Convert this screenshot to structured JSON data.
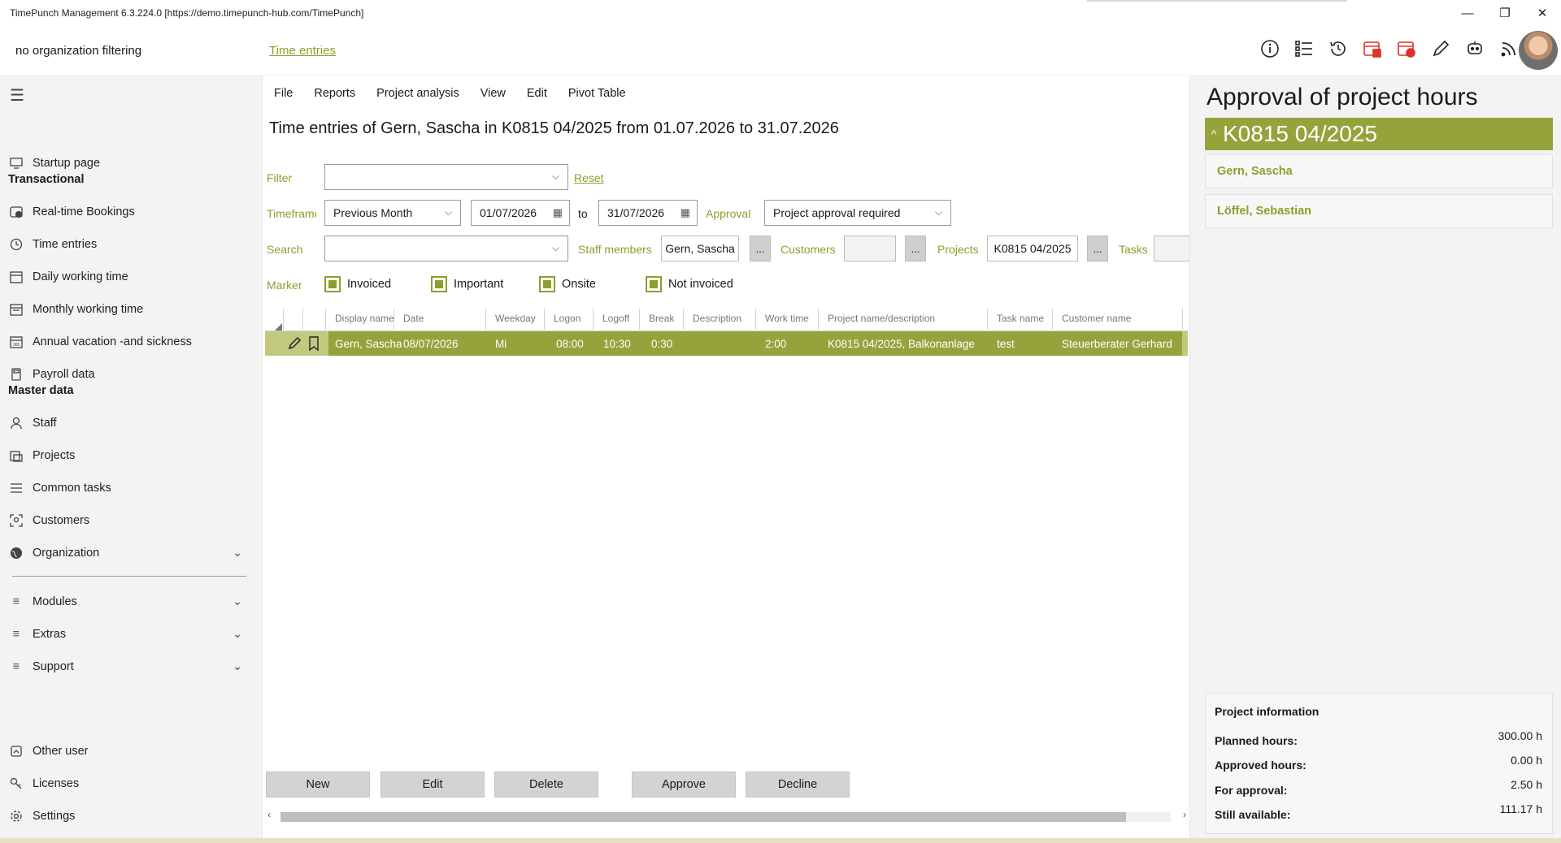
{
  "window": {
    "title": "TimePunch Management 6.3.224.0 [https://demo.timepunch-hub.com/TimePunch]",
    "controls": {
      "minimize": "—",
      "restore": "❐",
      "close": "✕"
    }
  },
  "header": {
    "org_filter": "no organization filtering",
    "breadcrumb": "Time entries",
    "icons": [
      "info-icon",
      "list-icon",
      "history-icon",
      "calendar-booking-icon",
      "calendar-clock-icon",
      "pencil-icon",
      "robot-icon",
      "rss-icon"
    ]
  },
  "sidebar": {
    "startup": "Startup page",
    "section_transactional": "Transactional",
    "transactional": [
      {
        "label": "Real-time Bookings",
        "icon": "stopwatch-icon"
      },
      {
        "label": "Time entries",
        "icon": "clock-icon"
      },
      {
        "label": "Daily working time",
        "icon": "calendar-day-icon"
      },
      {
        "label": "Monthly working time",
        "icon": "calendar-month-icon"
      },
      {
        "label": "Annual vacation -and sickness",
        "icon": "calendar-year-icon"
      },
      {
        "label": "Payroll data",
        "icon": "calculator-icon"
      }
    ],
    "section_master": "Master data",
    "master": [
      {
        "label": "Staff",
        "icon": "person-icon"
      },
      {
        "label": "Projects",
        "icon": "projects-icon"
      },
      {
        "label": "Common tasks",
        "icon": "tasks-icon"
      },
      {
        "label": "Customers",
        "icon": "customer-icon"
      },
      {
        "label": "Organization",
        "icon": "globe-icon"
      }
    ],
    "groups": [
      {
        "label": "Modules"
      },
      {
        "label": "Extras"
      },
      {
        "label": "Support"
      }
    ],
    "bottom": [
      {
        "label": "Other user",
        "icon": "other-user-icon"
      },
      {
        "label": "Licenses",
        "icon": "key-icon"
      },
      {
        "label": "Settings",
        "icon": "gear-icon"
      }
    ]
  },
  "menu": [
    "File",
    "Reports",
    "Project analysis",
    "View",
    "Edit",
    "Pivot Table"
  ],
  "main": {
    "title": "Time entries of Gern, Sascha in K0815 04/2025 from 01.07.2026 to 31.07.2026",
    "filter_label": "Filter",
    "filter_value": "",
    "reset": "Reset",
    "timeframe_label": "Timeframe",
    "timeframe_value": "Previous Month",
    "date_from": "01/07/2026",
    "to_label": "to",
    "date_to": "31/07/2026",
    "approval_label": "Approval",
    "approval_value": "Project approval required",
    "search_label": "Search",
    "search_value": "",
    "staff_label": "Staff members",
    "staff_value": "Gern, Sascha",
    "customers_label": "Customers",
    "customers_value": "",
    "projects_label": "Projects",
    "projects_value": "K0815 04/2025",
    "tasks_label": "Tasks",
    "dots": "...",
    "marker_label": "Marker",
    "markers": [
      "Invoiced",
      "Important",
      "Onsite",
      "Not invoiced"
    ]
  },
  "grid": {
    "columns": [
      "Display name",
      "Date",
      "Weekday",
      "Logon",
      "Logoff",
      "Break",
      "Description",
      "Work time",
      "Project name/description",
      "Task name",
      "Customer name"
    ],
    "rows": [
      {
        "display_name": "Gern, Sascha",
        "date": "08/07/2026",
        "weekday": "Mi",
        "logon": "08:00",
        "logoff": "10:30",
        "break": "0:30",
        "description": "",
        "work_time": "2:00",
        "project": "K0815 04/2025, Balkonanlage",
        "task": "test",
        "customer": "Steuerberater Gerhard"
      }
    ]
  },
  "buttons": {
    "new": "New",
    "edit": "Edit",
    "delete": "Delete",
    "approve": "Approve",
    "decline": "Decline"
  },
  "right": {
    "title": "Approval of project hours",
    "project": "K0815 04/2025",
    "people": [
      "Gern, Sascha",
      "Löffel, Sebastian"
    ],
    "info_title": "Project information",
    "info": [
      {
        "label": "Planned hours:",
        "value": "300.00 h"
      },
      {
        "label": "Approved hours:",
        "value": "0.00 h"
      },
      {
        "label": "For approval:",
        "value": "2.50 h"
      },
      {
        "label": "Still available:",
        "value": "111.17 h"
      }
    ]
  },
  "colors": {
    "accent": "#8c9f2e",
    "selected_row": "#96a33d",
    "alert_icon": "#d9342b"
  }
}
